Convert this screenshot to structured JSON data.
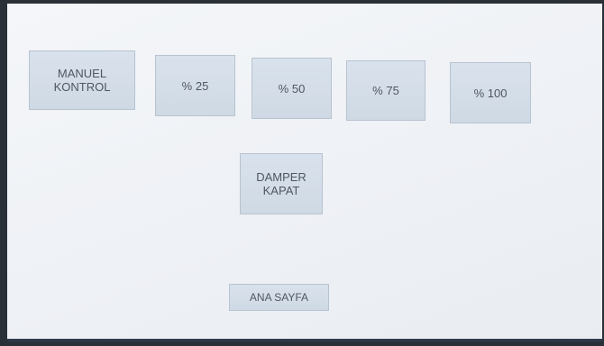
{
  "buttons": {
    "manual_control": "MANUEL\nKONTROL",
    "pct25": "% 25",
    "pct50": "% 50",
    "pct75": "% 75",
    "pct100": "% 100",
    "damper_close": "DAMPER\nKAPAT",
    "home": "ANA SAYFA"
  },
  "colors": {
    "button_bg": "#d3dce7",
    "button_text": "#4f5761",
    "screen_bg": "#eef1f5",
    "bezel": "#2a3038"
  }
}
